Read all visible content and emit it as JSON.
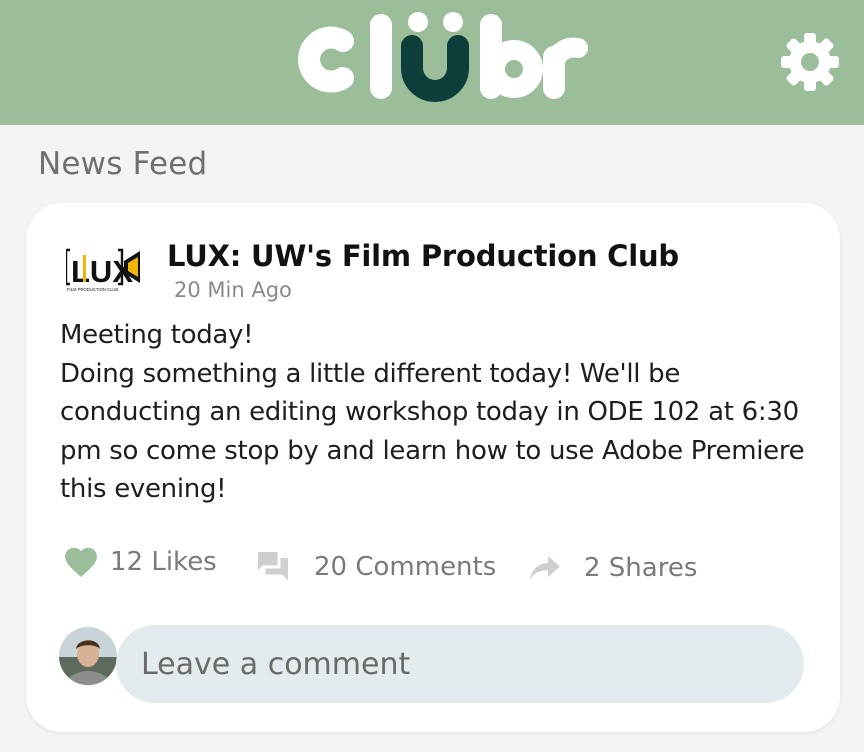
{
  "app": {
    "name": "clübr",
    "colors": {
      "header": "#9bbd99",
      "logo_white": "#ffffff",
      "logo_accent": "#0e3e3a"
    }
  },
  "header": {
    "settings_icon": "gear-icon"
  },
  "feed": {
    "title": "News Feed"
  },
  "post": {
    "club_logo_text": "LUX",
    "club_logo_subtext": "FILM PRODUCTION CLUB",
    "club_name": "LUX: UW's Film Production Club",
    "time": "20 Min Ago",
    "body_lines": [
      "Meeting today!",
      "Doing something a little different today! We'll be",
      "conducting an editing workshop today in ODE 102 at 6:30",
      "pm so come stop by and learn how to use Adobe Premiere",
      "this evening!"
    ],
    "likes_label": "12 Likes",
    "comments_label": "20 Comments",
    "shares_label": "2 Shares",
    "like_icon": "heart-icon",
    "comment_icon": "comment-icon",
    "share_icon": "share-arrow-icon"
  },
  "comment_input": {
    "placeholder": "Leave a comment",
    "value": ""
  }
}
